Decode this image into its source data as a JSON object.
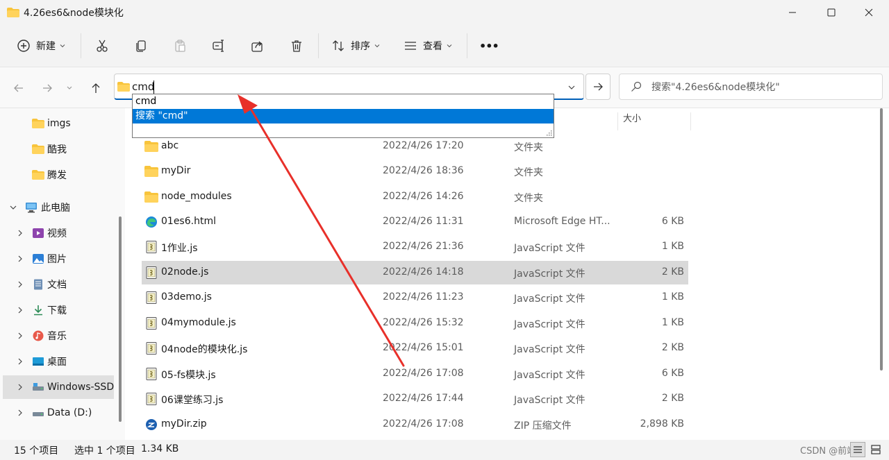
{
  "window": {
    "title": "4.26es6&node模块化",
    "colors": {
      "accent": "#005fb8",
      "folder": "#f8c43c",
      "selection": "#0078d7",
      "annotation": "#e8302a"
    }
  },
  "toolbar": {
    "new_label": "新建",
    "sort_label": "排序",
    "view_label": "查看",
    "more_label": "•••"
  },
  "address": {
    "value": "cmd",
    "search_placeholder": "搜索\"4.26es6&node模块化\"",
    "suggestions": [
      "cmd",
      "搜索 \"cmd\""
    ]
  },
  "sidebar": {
    "items": [
      {
        "label": "imgs",
        "icon": "folder-icon"
      },
      {
        "label": "酷我",
        "icon": "folder-icon"
      },
      {
        "label": "腾发",
        "icon": "folder-icon"
      },
      {
        "label": "此电脑",
        "icon": "pc-icon"
      },
      {
        "label": "视频",
        "icon": "video-icon"
      },
      {
        "label": "图片",
        "icon": "pictures-icon"
      },
      {
        "label": "文档",
        "icon": "documents-icon"
      },
      {
        "label": "下载",
        "icon": "download-icon"
      },
      {
        "label": "音乐",
        "icon": "music-icon"
      },
      {
        "label": "桌面",
        "icon": "desktop-icon"
      },
      {
        "label": "Windows-SSD",
        "icon": "drive-icon"
      },
      {
        "label": "Data (D:)",
        "icon": "drive-icon"
      }
    ]
  },
  "columns": {
    "size": "大小"
  },
  "files": [
    {
      "name": "abc",
      "date": "2022/4/26 17:20",
      "type": "文件夹",
      "size": "",
      "icon": "folder-icon"
    },
    {
      "name": "myDir",
      "date": "2022/4/26 18:36",
      "type": "文件夹",
      "size": "",
      "icon": "folder-icon"
    },
    {
      "name": "node_modules",
      "date": "2022/4/26 14:26",
      "type": "文件夹",
      "size": "",
      "icon": "folder-icon"
    },
    {
      "name": "01es6.html",
      "date": "2022/4/26 11:31",
      "type": "Microsoft Edge HT...",
      "size": "6 KB",
      "icon": "edge-icon"
    },
    {
      "name": "1作业.js",
      "date": "2022/4/26 21:36",
      "type": "JavaScript 文件",
      "size": "1 KB",
      "icon": "js-file-icon"
    },
    {
      "name": "02node.js",
      "date": "2022/4/26 14:18",
      "type": "JavaScript 文件",
      "size": "2 KB",
      "icon": "js-file-icon"
    },
    {
      "name": "03demo.js",
      "date": "2022/4/26 11:23",
      "type": "JavaScript 文件",
      "size": "1 KB",
      "icon": "js-file-icon"
    },
    {
      "name": "04mymodule.js",
      "date": "2022/4/26 15:32",
      "type": "JavaScript 文件",
      "size": "1 KB",
      "icon": "js-file-icon"
    },
    {
      "name": "04node的模块化.js",
      "date": "2022/4/26 15:01",
      "type": "JavaScript 文件",
      "size": "2 KB",
      "icon": "js-file-icon"
    },
    {
      "name": "05-fs模块.js",
      "date": "2022/4/26 17:08",
      "type": "JavaScript 文件",
      "size": "6 KB",
      "icon": "js-file-icon"
    },
    {
      "name": "06课堂练习.js",
      "date": "2022/4/26 17:44",
      "type": "JavaScript 文件",
      "size": "2 KB",
      "icon": "js-file-icon"
    },
    {
      "name": "myDir.zip",
      "date": "2022/4/26 17:08",
      "type": "ZIP 压缩文件",
      "size": "2,898 KB",
      "icon": "zip-icon"
    }
  ],
  "status": {
    "count": "15 个项目",
    "selected": "选中 1 个项目",
    "selected_size": "1.34 KB",
    "watermark": "CSDN @前端"
  }
}
